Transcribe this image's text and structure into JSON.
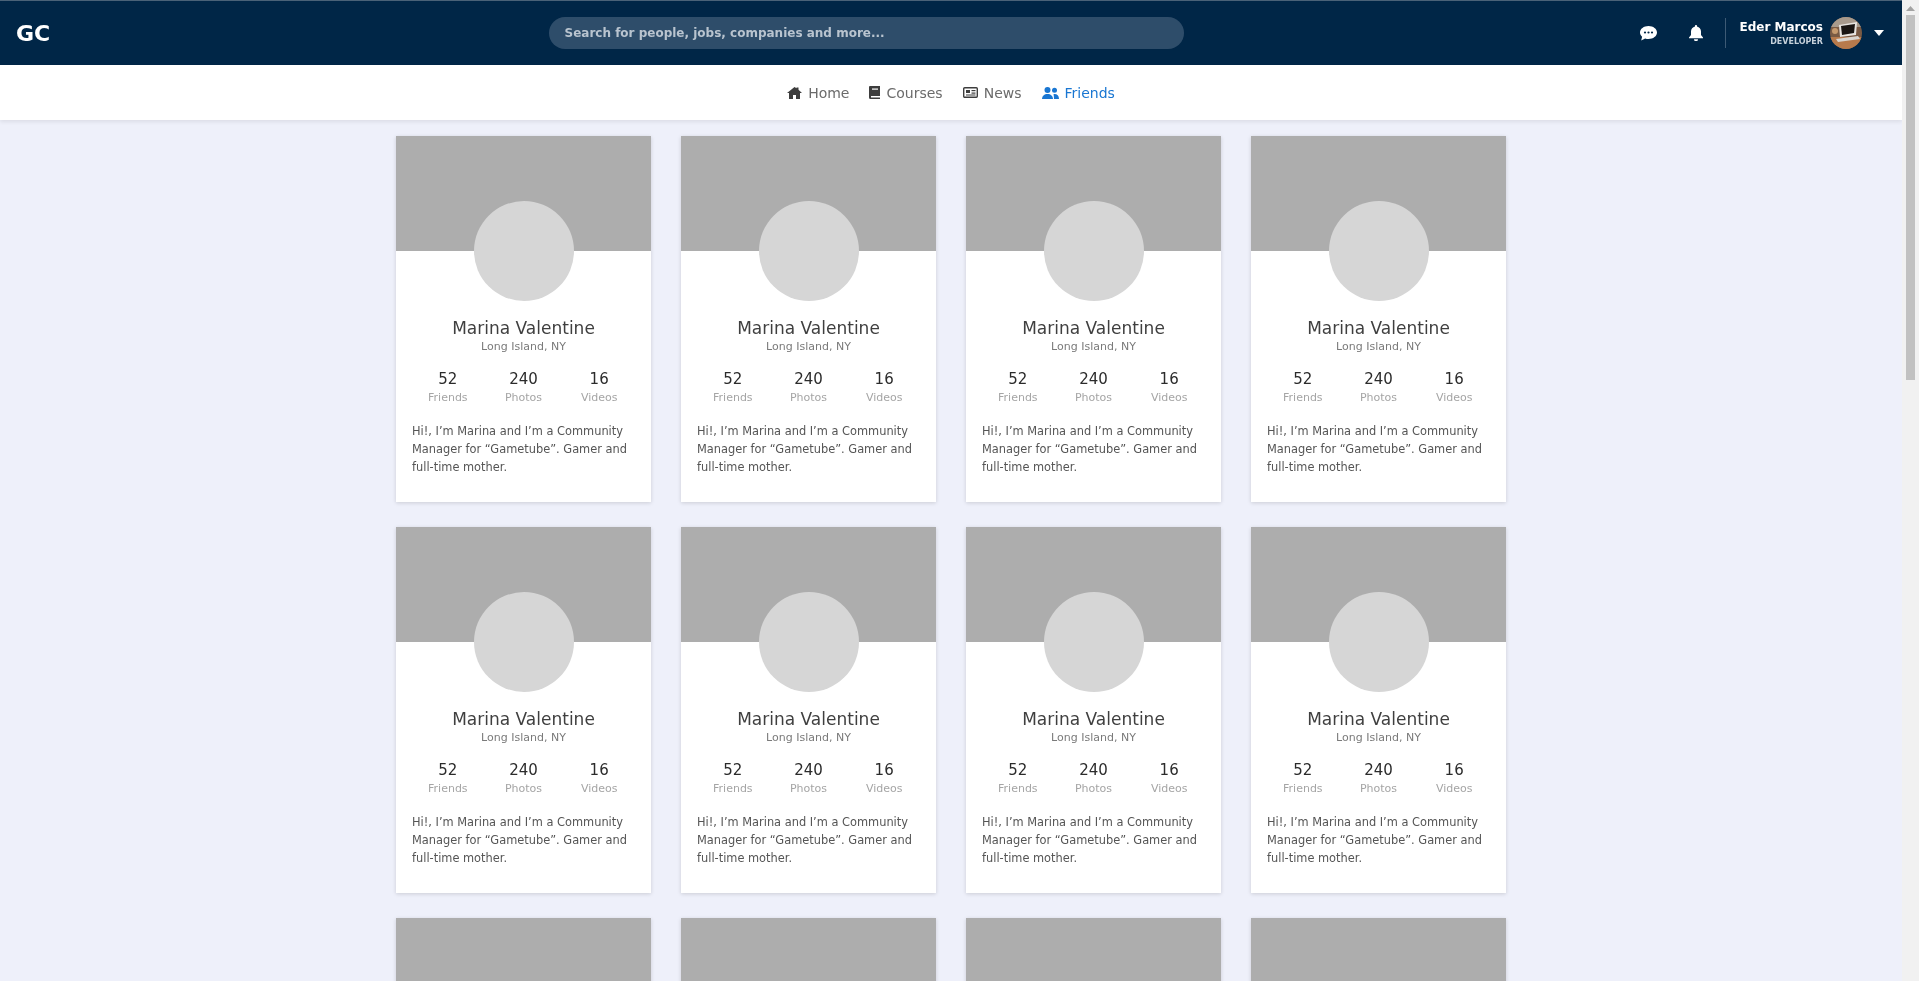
{
  "header": {
    "logo": "GC",
    "search": {
      "placeholder": "Search for people, jobs, companies and more..."
    },
    "user": {
      "name": "Eder Marcos",
      "role": "DEVELOPER"
    }
  },
  "nav": [
    {
      "label": "Home",
      "selected": false
    },
    {
      "label": "Courses",
      "selected": false
    },
    {
      "label": "News",
      "selected": false
    },
    {
      "label": "Friends",
      "selected": true
    }
  ],
  "cards": [
    {
      "kind": "full",
      "name": "Marina Valentine",
      "location": "Long Island, NY",
      "stats": [
        {
          "value": "52",
          "label": "Friends"
        },
        {
          "value": "240",
          "label": "Photos"
        },
        {
          "value": "16",
          "label": "Videos"
        }
      ],
      "bio": "Hi!, I’m Marina and I’m a Community Manager for “Gametube”. Gamer and full-time mother."
    },
    {
      "kind": "full",
      "name": "Marina Valentine",
      "location": "Long Island, NY",
      "stats": [
        {
          "value": "52",
          "label": "Friends"
        },
        {
          "value": "240",
          "label": "Photos"
        },
        {
          "value": "16",
          "label": "Videos"
        }
      ],
      "bio": "Hi!, I’m Marina and I’m a Community Manager for “Gametube”. Gamer and full-time mother."
    },
    {
      "kind": "full",
      "name": "Marina Valentine",
      "location": "Long Island, NY",
      "stats": [
        {
          "value": "52",
          "label": "Friends"
        },
        {
          "value": "240",
          "label": "Photos"
        },
        {
          "value": "16",
          "label": "Videos"
        }
      ],
      "bio": "Hi!, I’m Marina and I’m a Community Manager for “Gametube”. Gamer and full-time mother."
    },
    {
      "kind": "full",
      "name": "Marina Valentine",
      "location": "Long Island, NY",
      "stats": [
        {
          "value": "52",
          "label": "Friends"
        },
        {
          "value": "240",
          "label": "Photos"
        },
        {
          "value": "16",
          "label": "Videos"
        }
      ],
      "bio": "Hi!, I’m Marina and I’m a Community Manager for “Gametube”. Gamer and full-time mother."
    },
    {
      "kind": "full",
      "name": "Marina Valentine",
      "location": "Long Island, NY",
      "stats": [
        {
          "value": "52",
          "label": "Friends"
        },
        {
          "value": "240",
          "label": "Photos"
        },
        {
          "value": "16",
          "label": "Videos"
        }
      ],
      "bio": "Hi!, I’m Marina and I’m a Community Manager for “Gametube”. Gamer and full-time mother."
    },
    {
      "kind": "full",
      "name": "Marina Valentine",
      "location": "Long Island, NY",
      "stats": [
        {
          "value": "52",
          "label": "Friends"
        },
        {
          "value": "240",
          "label": "Photos"
        },
        {
          "value": "16",
          "label": "Videos"
        }
      ],
      "bio": "Hi!, I’m Marina and I’m a Community Manager for “Gametube”. Gamer and full-time mother."
    },
    {
      "kind": "full",
      "name": "Marina Valentine",
      "location": "Long Island, NY",
      "stats": [
        {
          "value": "52",
          "label": "Friends"
        },
        {
          "value": "240",
          "label": "Photos"
        },
        {
          "value": "16",
          "label": "Videos"
        }
      ],
      "bio": "Hi!, I’m Marina and I’m a Community Manager for “Gametube”. Gamer and full-time mother."
    },
    {
      "kind": "full",
      "name": "Marina Valentine",
      "location": "Long Island, NY",
      "stats": [
        {
          "value": "52",
          "label": "Friends"
        },
        {
          "value": "240",
          "label": "Photos"
        },
        {
          "value": "16",
          "label": "Videos"
        }
      ],
      "bio": "Hi!, I’m Marina and I’m a Community Manager for “Gametube”. Gamer and full-time mother."
    },
    {
      "kind": "cover_only"
    },
    {
      "kind": "cover_only"
    },
    {
      "kind": "cover_only"
    },
    {
      "kind": "cover_only"
    }
  ]
}
